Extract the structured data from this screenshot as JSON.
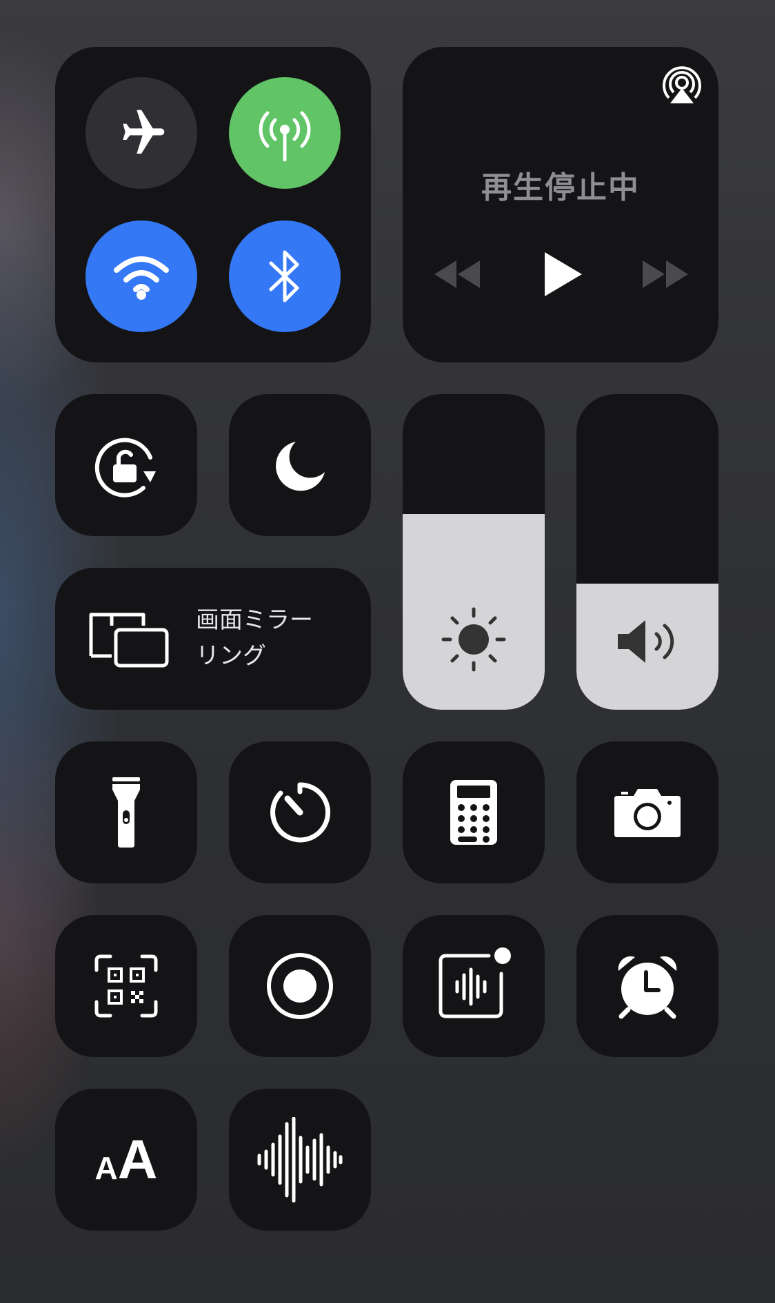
{
  "connectivity": {
    "airplane": {
      "icon": "airplane-icon",
      "state": "off",
      "color": "#303034"
    },
    "cellular": {
      "icon": "cellular-antenna-icon",
      "state": "on",
      "color": "#61c466"
    },
    "wifi": {
      "icon": "wifi-icon",
      "state": "on",
      "color": "#3478f6"
    },
    "bluetooth": {
      "icon": "bluetooth-icon",
      "state": "on",
      "color": "#3478f6"
    }
  },
  "media": {
    "status_text": "再生停止中",
    "airplay_icon": "airplay-audio-icon",
    "controls": [
      "rewind-icon",
      "play-icon",
      "fast-forward-icon"
    ]
  },
  "screen_mirroring": {
    "label_line1": "画面ミラー",
    "label_line2": "リング",
    "icon": "screen-mirroring-icon"
  },
  "orientation_lock": {
    "icon": "orientation-lock-icon"
  },
  "do_not_disturb": {
    "icon": "moon-icon"
  },
  "brightness": {
    "icon": "sun-icon",
    "level": 0.62
  },
  "volume": {
    "icon": "speaker-icon",
    "level": 0.4
  },
  "shortcuts": [
    {
      "name": "flashlight",
      "icon": "flashlight-icon"
    },
    {
      "name": "timer",
      "icon": "timer-icon"
    },
    {
      "name": "calculator",
      "icon": "calculator-icon"
    },
    {
      "name": "camera",
      "icon": "camera-icon"
    },
    {
      "name": "qr-code-scanner",
      "icon": "qr-code-icon"
    },
    {
      "name": "screen-recording",
      "icon": "record-icon"
    },
    {
      "name": "voice-memos",
      "icon": "voice-memo-icon"
    },
    {
      "name": "alarm",
      "icon": "alarm-clock-icon"
    },
    {
      "name": "text-size",
      "icon": "text-size-icon",
      "glyph_small": "A",
      "glyph_large": "A"
    },
    {
      "name": "sound-recognition",
      "icon": "sound-wave-icon"
    }
  ],
  "colors": {
    "tile": "#141416",
    "green": "#61c466",
    "blue": "#3478f6",
    "slider": "#d5d5d8"
  }
}
